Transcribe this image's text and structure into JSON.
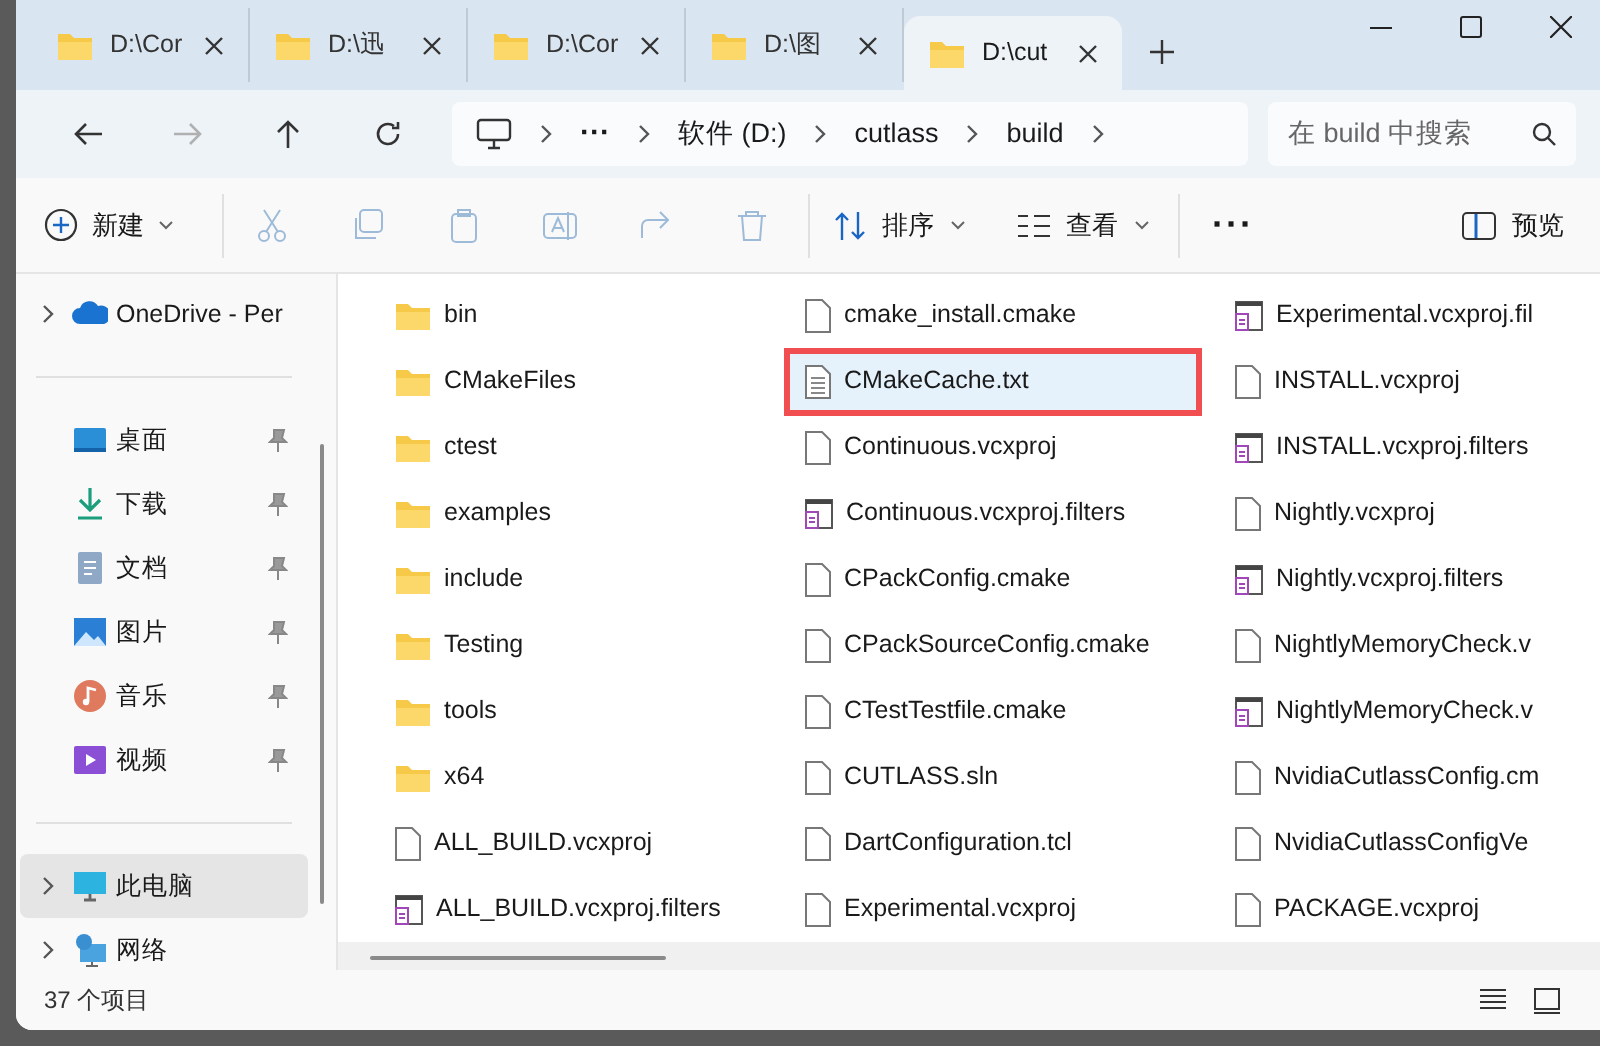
{
  "tabs": [
    {
      "label": "D:\\Cor",
      "selected": false
    },
    {
      "label": "D:\\迅",
      "selected": false
    },
    {
      "label": "D:\\Cor",
      "selected": false
    },
    {
      "label": "D:\\图",
      "selected": false
    },
    {
      "label": "D:\\cut",
      "selected": true
    }
  ],
  "navigation": {
    "back_disabled": false,
    "forward_disabled": true
  },
  "address_bar": {
    "segments": [
      "···",
      "软件 (D:)",
      "cutlass",
      "build"
    ]
  },
  "search": {
    "placeholder": "在 build 中搜索"
  },
  "toolbar": {
    "new_label": "新建",
    "sort_label": "排序",
    "view_label": "查看",
    "more_label": "···",
    "preview_label": "预览",
    "edit_actions_disabled": true
  },
  "sidebar": {
    "items": [
      {
        "kind": "onedrive",
        "label": "OneDrive - Per",
        "expandable": true,
        "pinned": false,
        "selected": false
      },
      {
        "kind": "divider"
      },
      {
        "kind": "desktop",
        "label": "桌面",
        "expandable": false,
        "pinned": true,
        "selected": false
      },
      {
        "kind": "downloads",
        "label": "下载",
        "expandable": false,
        "pinned": true,
        "selected": false
      },
      {
        "kind": "documents",
        "label": "文档",
        "expandable": false,
        "pinned": true,
        "selected": false
      },
      {
        "kind": "pictures",
        "label": "图片",
        "expandable": false,
        "pinned": true,
        "selected": false
      },
      {
        "kind": "music",
        "label": "音乐",
        "expandable": false,
        "pinned": true,
        "selected": false
      },
      {
        "kind": "videos",
        "label": "视频",
        "expandable": false,
        "pinned": true,
        "selected": false
      },
      {
        "kind": "divider"
      },
      {
        "kind": "pc",
        "label": "此电脑",
        "expandable": true,
        "pinned": false,
        "selected": true
      },
      {
        "kind": "network",
        "label": "网络",
        "expandable": true,
        "pinned": false,
        "selected": false
      }
    ]
  },
  "files": [
    {
      "kind": "folder",
      "name": "bin",
      "selected": false,
      "annotated": false
    },
    {
      "kind": "folder",
      "name": "CMakeFiles",
      "selected": false,
      "annotated": false
    },
    {
      "kind": "folder",
      "name": "ctest",
      "selected": false,
      "annotated": false
    },
    {
      "kind": "folder",
      "name": "examples",
      "selected": false,
      "annotated": false
    },
    {
      "kind": "folder",
      "name": "include",
      "selected": false,
      "annotated": false
    },
    {
      "kind": "folder",
      "name": "Testing",
      "selected": false,
      "annotated": false
    },
    {
      "kind": "folder",
      "name": "tools",
      "selected": false,
      "annotated": false
    },
    {
      "kind": "folder",
      "name": "x64",
      "selected": false,
      "annotated": false
    },
    {
      "kind": "file",
      "name": "ALL_BUILD.vcxproj",
      "selected": false,
      "annotated": false
    },
    {
      "kind": "filters",
      "name": "ALL_BUILD.vcxproj.filters",
      "selected": false,
      "annotated": false
    },
    {
      "kind": "file",
      "name": "cmake_install.cmake",
      "selected": false,
      "annotated": false
    },
    {
      "kind": "text",
      "name": "CMakeCache.txt",
      "selected": true,
      "annotated": true
    },
    {
      "kind": "file",
      "name": "Continuous.vcxproj",
      "selected": false,
      "annotated": false
    },
    {
      "kind": "filters",
      "name": "Continuous.vcxproj.filters",
      "selected": false,
      "annotated": false
    },
    {
      "kind": "file",
      "name": "CPackConfig.cmake",
      "selected": false,
      "annotated": false
    },
    {
      "kind": "file",
      "name": "CPackSourceConfig.cmake",
      "selected": false,
      "annotated": false
    },
    {
      "kind": "file",
      "name": "CTestTestfile.cmake",
      "selected": false,
      "annotated": false
    },
    {
      "kind": "file",
      "name": "CUTLASS.sln",
      "selected": false,
      "annotated": false
    },
    {
      "kind": "file",
      "name": "DartConfiguration.tcl",
      "selected": false,
      "annotated": false
    },
    {
      "kind": "file",
      "name": "Experimental.vcxproj",
      "selected": false,
      "annotated": false
    },
    {
      "kind": "filters",
      "name": "Experimental.vcxproj.fil",
      "selected": false,
      "annotated": false
    },
    {
      "kind": "file",
      "name": "INSTALL.vcxproj",
      "selected": false,
      "annotated": false
    },
    {
      "kind": "filters",
      "name": "INSTALL.vcxproj.filters",
      "selected": false,
      "annotated": false
    },
    {
      "kind": "file",
      "name": "Nightly.vcxproj",
      "selected": false,
      "annotated": false
    },
    {
      "kind": "filters",
      "name": "Nightly.vcxproj.filters",
      "selected": false,
      "annotated": false
    },
    {
      "kind": "file",
      "name": "NightlyMemoryCheck.v",
      "selected": false,
      "annotated": false
    },
    {
      "kind": "filters",
      "name": "NightlyMemoryCheck.v",
      "selected": false,
      "annotated": false
    },
    {
      "kind": "file",
      "name": "NvidiaCutlassConfig.cm",
      "selected": false,
      "annotated": false
    },
    {
      "kind": "file",
      "name": "NvidiaCutlassConfigVe",
      "selected": false,
      "annotated": false
    },
    {
      "kind": "file",
      "name": "PACKAGE.vcxproj",
      "selected": false,
      "annotated": false
    }
  ],
  "status_bar": {
    "item_count": "37 个项目"
  }
}
